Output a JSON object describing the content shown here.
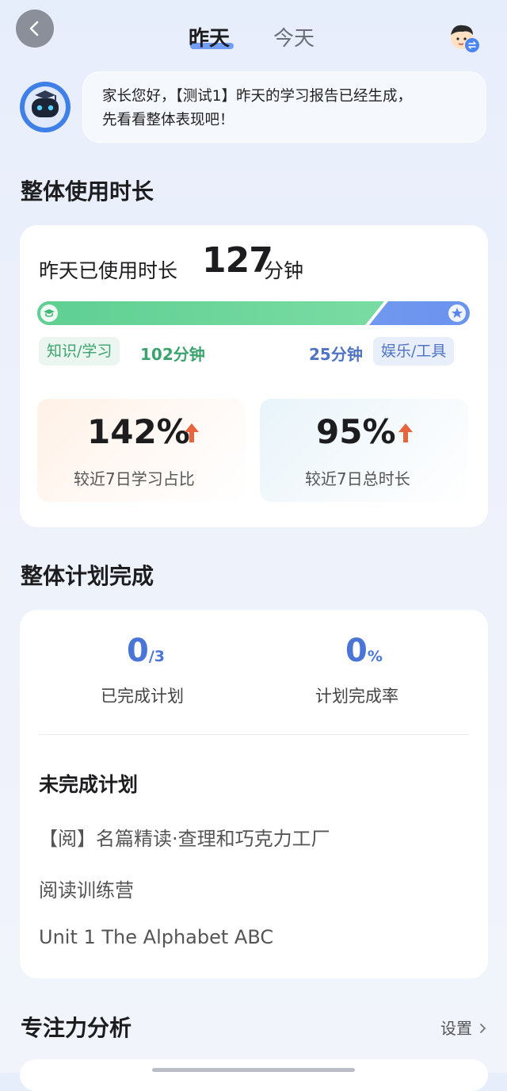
{
  "header": {
    "tab_yesterday": "昨天",
    "tab_today": "今天",
    "back_icon": "chevron-left-icon",
    "switch_icon": "child-avatar-switch-icon"
  },
  "greeting": {
    "line1": "家长您好，【测试1】昨天的学习报告已经生成，",
    "line2": "先看看整体表现吧！"
  },
  "usage": {
    "section_title": "整体使用时长",
    "label": "昨天已使用时长",
    "total": "127",
    "unit": "分钟",
    "study_label": "知识/学习",
    "study_minutes": "102分钟",
    "fun_minutes": "25分钟",
    "fun_label": "娱乐/工具",
    "study_fraction": 0.803,
    "stats": [
      {
        "value": "142%",
        "caption": "较近7日学习占比",
        "trend": "up"
      },
      {
        "value": "95%",
        "caption": "较近7日总时长",
        "trend": "up"
      }
    ],
    "colors": {
      "study": "#6cd39a",
      "fun": "#7a9ff0",
      "trend_up": "#e8643c"
    }
  },
  "plan": {
    "section_title": "整体计划完成",
    "completed": "0",
    "completed_total": "/3",
    "completed_label": "已完成计划",
    "rate": "0",
    "rate_unit": "%",
    "rate_label": "计划完成率",
    "unfinished_title": "未完成计划",
    "unfinished_items": [
      "【阅】名篇精读·查理和巧克力工厂",
      "阅读训练营",
      "Unit 1 The Alphabet ABC"
    ]
  },
  "focus": {
    "section_title": "专注力分析",
    "settings_label": "设置"
  }
}
